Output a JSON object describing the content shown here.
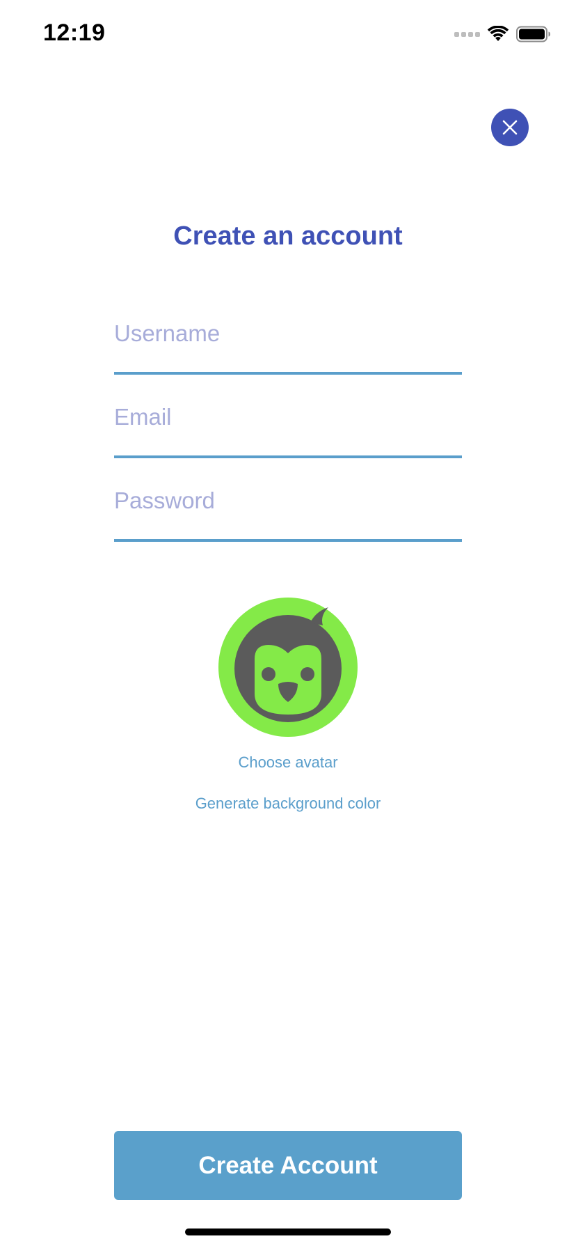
{
  "status_bar": {
    "time": "12:19",
    "wifi_icon": "wifi-icon",
    "battery_icon": "battery-icon"
  },
  "close_button": {
    "icon": "close-icon",
    "color": "#3f51b5"
  },
  "title": "Create an account",
  "fields": {
    "username_placeholder": "Username",
    "email_placeholder": "Email",
    "password_placeholder": "Password",
    "underline_color": "#5a9ecb"
  },
  "avatar": {
    "icon": "penguin-avatar-icon",
    "background_color": "#84ea48"
  },
  "choose_avatar_label": "Choose avatar",
  "generate_bg_label": "Generate background color",
  "create_button_label": "Create Account",
  "colors": {
    "accent": "#3f51b5",
    "primary_button": "#5aa0cb",
    "placeholder": "#a7acd9"
  }
}
